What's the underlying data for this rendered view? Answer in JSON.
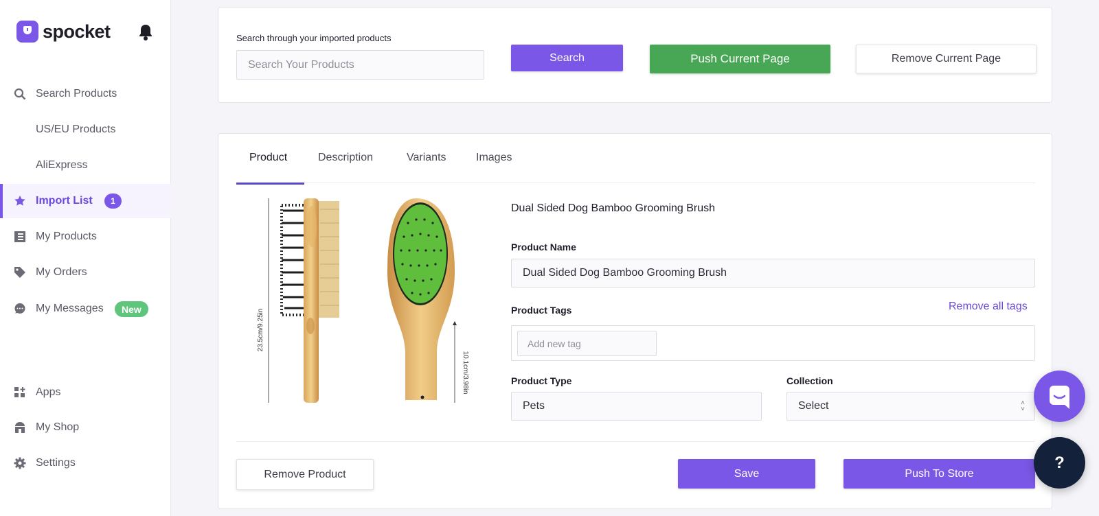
{
  "brand": {
    "name": "spocket",
    "accent": "#7a57e6"
  },
  "sidebar": {
    "items": [
      {
        "label": "Search Products",
        "icon": "search-icon"
      },
      {
        "label": "US/EU Products"
      },
      {
        "label": "AliExpress"
      },
      {
        "label": "Import List",
        "icon": "star-icon",
        "badge": "1",
        "active": true
      },
      {
        "label": "My Products",
        "icon": "list-icon"
      },
      {
        "label": "My Orders",
        "icon": "tag-icon"
      },
      {
        "label": "My Messages",
        "icon": "chat-bubble-icon",
        "badge": "New"
      },
      {
        "label": "Apps",
        "icon": "apps-grid-icon"
      },
      {
        "label": "My Shop",
        "icon": "shop-icon"
      },
      {
        "label": "Settings",
        "icon": "gear-icon"
      }
    ]
  },
  "search": {
    "label": "Search through your imported products",
    "placeholder": "Search Your Products",
    "search_button": "Search",
    "push_page_button": "Push Current Page",
    "remove_page_button": "Remove Current Page"
  },
  "product": {
    "tabs": [
      "Product",
      "Description",
      "Variants",
      "Images"
    ],
    "active_tab": "Product",
    "title": "Dual Sided Dog Bamboo Grooming Brush",
    "image_labels": {
      "height": "23.5cm/9.25in",
      "width": "10.1cm/3.98in"
    },
    "name_label": "Product Name",
    "name_value": "Dual Sided Dog Bamboo Grooming Brush",
    "tags_label": "Product Tags",
    "remove_tags": "Remove all tags",
    "tag_placeholder": "Add new tag",
    "type_label": "Product Type",
    "type_value": "Pets",
    "collection_label": "Collection",
    "collection_value": "Select",
    "remove_button": "Remove Product",
    "save_button": "Save",
    "push_button": "Push To Store"
  },
  "floating": {
    "help": "?"
  }
}
